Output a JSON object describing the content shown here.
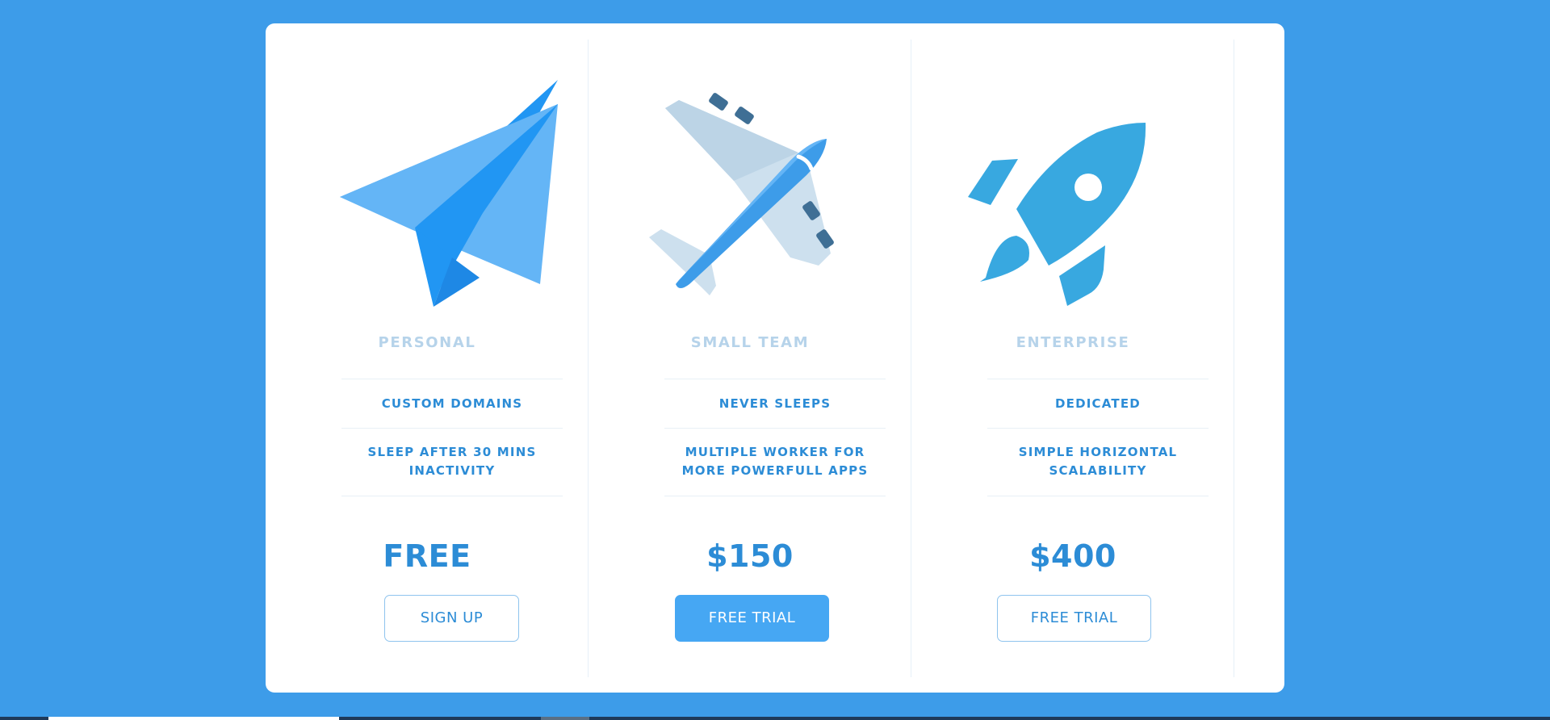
{
  "plans": [
    {
      "icon": "paper-plane-icon",
      "name": "PERSONAL",
      "features": [
        "CUSTOM DOMAINS",
        "SLEEP AFTER 30 MINS INACTIVITY"
      ],
      "price": "FREE",
      "button": "SIGN UP"
    },
    {
      "icon": "airplane-icon",
      "name": "SMALL TEAM",
      "features": [
        "NEVER SLEEPS",
        "MULTIPLE WORKER FOR MORE POWERFULL APPS"
      ],
      "price": "$150",
      "button": "FREE TRIAL"
    },
    {
      "icon": "rocket-icon",
      "name": "ENTERPRISE",
      "features": [
        "DEDICATED",
        "SIMPLE HORIZONTAL SCALABILITY"
      ],
      "price": "$400",
      "button": "FREE TRIAL"
    }
  ],
  "colors": {
    "background": "#3d9ce9",
    "accent": "#2c8cd6",
    "primary_button": "#46a7f3"
  }
}
